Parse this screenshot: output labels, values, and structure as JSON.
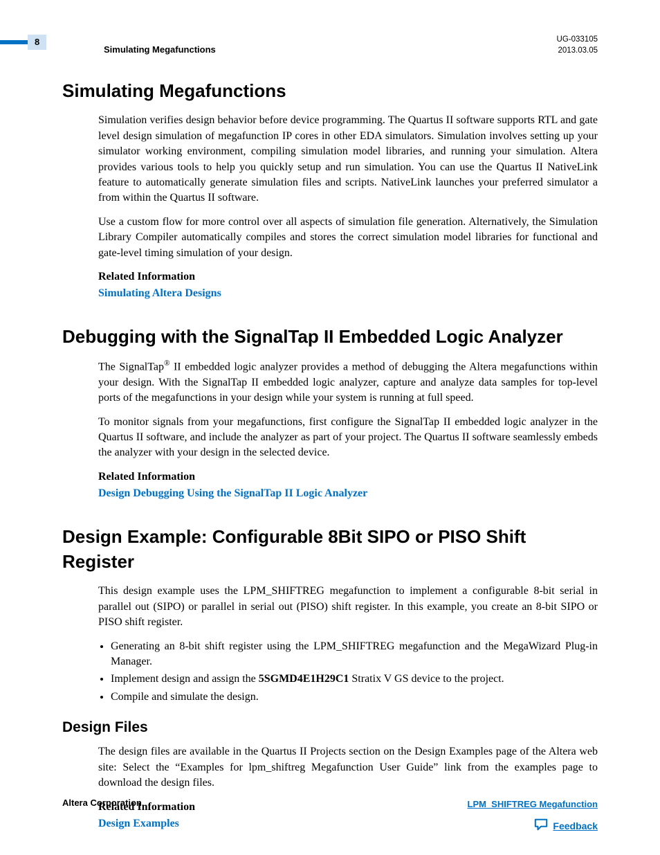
{
  "header": {
    "page_number": "8",
    "running_title": "Simulating Megafunctions",
    "doc_id": "UG-033105",
    "date": "2013.03.05"
  },
  "sections": [
    {
      "heading": "Simulating Megafunctions",
      "paragraphs": [
        "Simulation verifies design behavior before device programming. The Quartus II software supports RTL and gate level design simulation of megafunction IP cores in other EDA simulators. Simulation involves setting up your simulator working environment, compiling simulation model libraries, and running your simulation. Altera provides various tools to help you quickly setup and run simulation. You can use the Quartus II NativeLink feature to automatically generate simulation files and scripts. NativeLink launches your preferred simulator a from within the Quartus II software.",
        "Use a custom flow for more control over all aspects of simulation file generation. Alternatively, the Simulation Library Compiler automatically compiles and stores the correct simulation model libraries for functional and gate-level timing simulation of your design."
      ],
      "related_label": "Related Information",
      "related_link": "Simulating Altera Designs"
    },
    {
      "heading": "Debugging with the SignalTap II Embedded Logic Analyzer",
      "paragraphs_html": [
        "The SignalTap<sup>®</sup> II embedded logic analyzer provides a method of debugging the Altera megafunctions within your design. With the SignalTap II embedded logic analyzer, capture and analyze data samples for top-level ports of the megafunctions in your design while your system is running at full speed.",
        "To monitor signals from your megafunctions, first configure the SignalTap II embedded logic analyzer in the Quartus II software, and include the analyzer as part of your project. The Quartus II software seamlessly embeds the analyzer with your design in the selected device."
      ],
      "related_label": "Related Information",
      "related_link": "Design Debugging Using the SignalTap II Logic Analyzer"
    },
    {
      "heading": "Design Example: Configurable 8Bit SIPO or PISO Shift Register",
      "intro": "This design example uses the LPM_SHIFTREG megafunction to implement a configurable 8-bit serial in parallel out (SIPO) or parallel in serial out (PISO) shift register. In this example, you create an 8-bit SIPO or PISO shift register.",
      "bullets_html": [
        "Generating an 8-bit shift register using the LPM_SHIFTREG megafunction and the MegaWizard Plug-in Manager.",
        "Implement design and assign the <strong>5SGMD4E1H29C1</strong> Stratix V GS device to the project.",
        "Compile and simulate the design."
      ],
      "subheading": "Design Files",
      "sub_para": "The design files are available in the Quartus II Projects section on the Design Examples page of the Altera web site: Select the “Examples for lpm_shiftreg Megafunction User Guide” link from the examples page to download the design files.",
      "related_label": "Related Information",
      "related_link": "Design Examples"
    }
  ],
  "footer": {
    "left": "Altera Corporation",
    "right_link": "LPM_SHIFTREG Megafunction",
    "feedback": "Feedback"
  }
}
